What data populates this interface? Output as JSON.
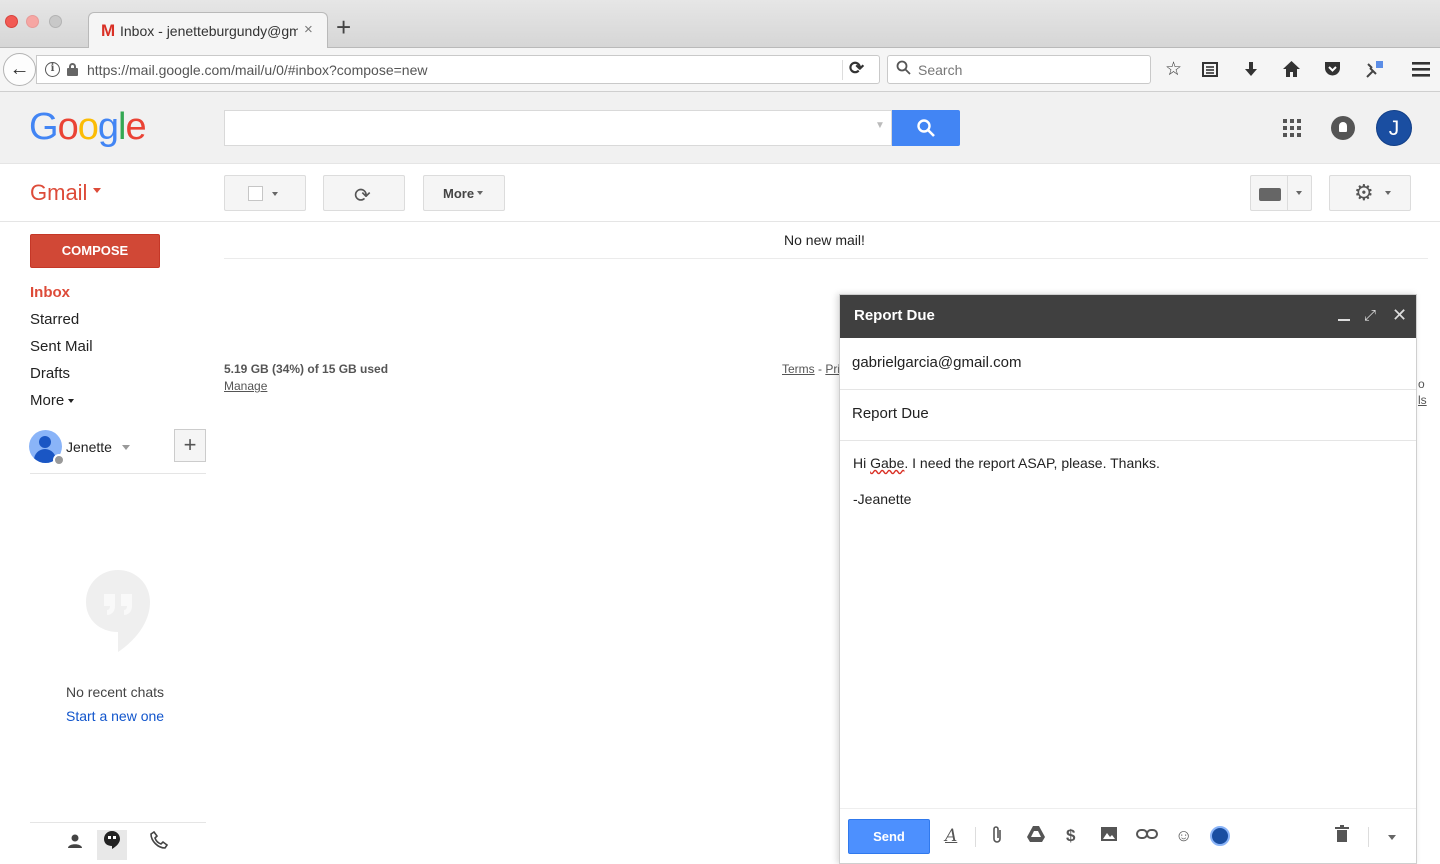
{
  "browser": {
    "tab_favicon": "M",
    "tab_title": "Inbox - jenetteburgundy@gm",
    "tab_close": "×",
    "new_tab": "+",
    "back": "←",
    "url": "https://mail.google.com/mail/u/0/#inbox?compose=new",
    "reload": "⟳",
    "search_placeholder": "Search",
    "search_icon": "🔍︎",
    "toolbar_icons": [
      "bookmark-star-icon",
      "reading-list-icon",
      "download-icon",
      "home-icon",
      "pocket-icon",
      "extension-icon",
      "menu-icon"
    ]
  },
  "header": {
    "logo": [
      "G",
      "o",
      "o",
      "g",
      "l",
      "e"
    ],
    "logo_colors": [
      "#4285f4",
      "#ea4335",
      "#fbbc05",
      "#4285f4",
      "#34a853",
      "#ea4335"
    ],
    "account_initial": "J",
    "search_button_color": "#4285f4"
  },
  "toolbar": {
    "gmail_label": "Gmail",
    "more_label": "More",
    "refresh": "⟳",
    "settings": "⚙"
  },
  "sidebar": {
    "compose_label": "COMPOSE",
    "items": [
      {
        "label": "Inbox",
        "active": true
      },
      {
        "label": "Starred"
      },
      {
        "label": "Sent Mail"
      },
      {
        "label": "Drafts"
      },
      {
        "label": "More"
      }
    ],
    "hangouts_user": "Jenette",
    "add": "+",
    "no_recent_chats": "No recent chats",
    "start_new": "Start a new one",
    "bottom_icons": [
      "contacts-icon",
      "hangouts-icon",
      "phone-icon"
    ]
  },
  "main": {
    "no_new_mail": "No new mail!",
    "storage": "5.19 GB (34%) of 15 GB used",
    "manage": "Manage",
    "terms_prefix": "Terms",
    "terms_sep": " - ",
    "terms_rest": "Privacy",
    "right_fragment_1": "o",
    "right_fragment_2": "ls"
  },
  "compose": {
    "title": "Report Due",
    "close": "✕",
    "expand": "⤢",
    "to": "gabrielgarcia@gmail.com",
    "subject": "Report Due",
    "body_pre": "Hi ",
    "body_misspelled": "Gabe",
    "body_post": ". I need the report ASAP, please. Thanks.",
    "signature": "-Jeanette",
    "send_label": "Send",
    "send_color": "#4d90fe",
    "footer_icons": [
      "formatting-icon",
      "attach-icon",
      "drive-icon",
      "money-icon",
      "photo-icon",
      "link-icon",
      "emoji-icon",
      "encrypt-icon",
      "trash-icon",
      "more-options-icon"
    ]
  }
}
